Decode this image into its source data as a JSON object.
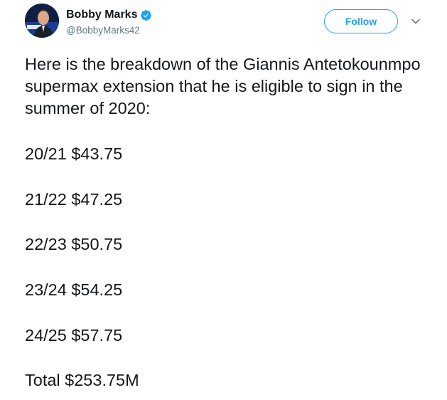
{
  "author": {
    "display_name": "Bobby Marks",
    "handle": "@BobbyMarks42",
    "verified": true
  },
  "actions": {
    "follow_label": "Follow"
  },
  "tweet": {
    "intro": "Here is the breakdown of the Giannis Antetokounmpo supermax extension that he is eligible to sign in the summer of 2020:",
    "lines": [
      "20/21 $43.75",
      "21/22 $47.25",
      "22/23 $50.75",
      "23/24 $54.25",
      "24/25 $57.75",
      "Total $253.75M"
    ]
  },
  "colors": {
    "accent": "#1da1f2",
    "text": "#14171a",
    "secondary_text": "#657786"
  },
  "icons": {
    "verified": "verified-badge-icon",
    "caret": "chevron-down-icon"
  }
}
